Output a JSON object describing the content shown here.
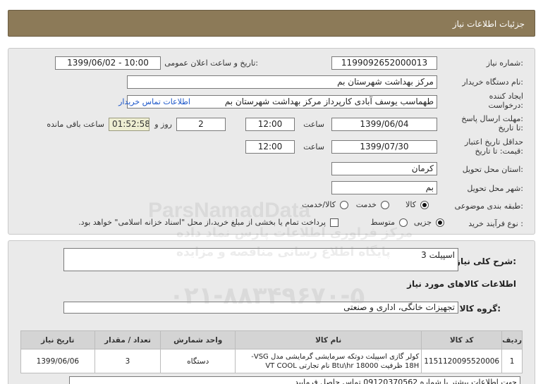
{
  "header": {
    "title": "جزئیات اطلاعات نیاز"
  },
  "form": {
    "need_number_label": "شماره نیاز:",
    "need_number": "1199092652000013",
    "announce_label": "تاریخ و ساعت اعلان عمومی:",
    "announce_value": "1399/06/02 - 10:00",
    "buyer_label": "نام دستگاه خریدار:",
    "buyer_value": "مرکز بهداشت شهرستان بم",
    "creator_label_1": "ایجاد کننده",
    "creator_label_2": "درخواست:",
    "creator_value": "طهماسب یوسف آبادی کارپرداز مرکز بهداشت شهرستان بم",
    "contact_link": "اطلاعات تماس خریدار",
    "deadline_label_1": "مهلت ارسال پاسخ:",
    "deadline_label_2": "تا تاریخ:",
    "deadline_date": "1399/06/04",
    "time_label": "ساعت",
    "deadline_time": "12:00",
    "days_value": "2",
    "days_label": "روز و",
    "remaining_timer": "01:52:58",
    "remaining_label": "ساعت باقی مانده",
    "validity_label_1": "حداقل تاریخ اعتبار",
    "validity_label_2": "قیمت: تا تاریخ:",
    "validity_date": "1399/07/30",
    "validity_time_label": "ساعت",
    "validity_time": "12:00",
    "province_label": "استان محل تحویل:",
    "province_value": "کرمان",
    "city_label": "شهر محل تحویل:",
    "city_value": "بم",
    "category_label": "طبقه بندی موضوعی:",
    "category_options": [
      "کالا",
      "خدمت",
      "کالا/خدمت"
    ],
    "category_selected": "کالا",
    "process_label": "نوع فرآیند خرید :",
    "process_options": [
      "جزیی",
      "متوسط"
    ],
    "process_selected": "جزیی",
    "payment_note": "پرداخت تمام یا بخشی از مبلغ خرید،از محل \"اسناد خزانه اسلامی\" خواهد بود."
  },
  "summary": {
    "label": "شرح کلی نیاز:",
    "value": "اسپیلت 3",
    "goods_title": "اطلاعات کالاهای مورد نیاز",
    "group_label": "گروه کالا:",
    "group_value": "تجهیزات خانگی، اداری و صنعتی"
  },
  "table": {
    "headers": [
      "ردیف",
      "کد کالا",
      "نام کالا",
      "واحد شمارش",
      "تعداد / مقدار",
      "تاریخ نیاز"
    ],
    "rows": [
      {
        "row": "1",
        "code": "1151120095520006",
        "name_line1": "کولر گازی اسپیلت دوتکه سرمایشی گرمایشی مدل VSG-",
        "name_line2": "18H ظرفیت 18000 Btu\\hr نام تجارتی VT COOL",
        "unit": "دستگاه",
        "qty": "3",
        "date": "1399/06/06"
      }
    ]
  },
  "footer_partial": "جهت اطلاعات بیشتر با شماره 09120370562 تماس حاصل فرمایید",
  "watermark": {
    "brand": "ParsNamadData",
    "line1": "مرکز فراوری اطلاعات پارس نماد داده",
    "line2": "پایگاه اطلاع رسانی مناقصه و مزایده",
    "phone": "۰۲۱-۸۸۳۴۹۶۷۰-۵"
  }
}
